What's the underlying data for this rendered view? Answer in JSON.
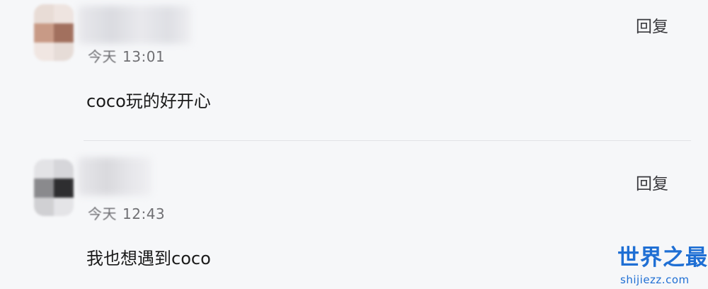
{
  "comments": [
    {
      "time_day": "今天",
      "time": "13:01",
      "text": "coco玩的好开心",
      "reply_label": "回复",
      "avatar_colors": [
        "#c89a86",
        "#a2705e",
        "#f0e6e2",
        "#ece4df",
        "#dcd0ca",
        "#eae2dd"
      ]
    },
    {
      "time_day": "今天",
      "time": "12:43",
      "text": "我也想遇到coco",
      "reply_label": "回复",
      "avatar_colors": [
        "#e3e3e6",
        "#d6d6da",
        "#8a8a8d",
        "#2e2e30",
        "#d0d0d3",
        "#e4e4e7"
      ]
    }
  ],
  "watermark": {
    "title": "世界之最",
    "url": "shijiezz.com",
    "color": "#1f6fd4"
  }
}
